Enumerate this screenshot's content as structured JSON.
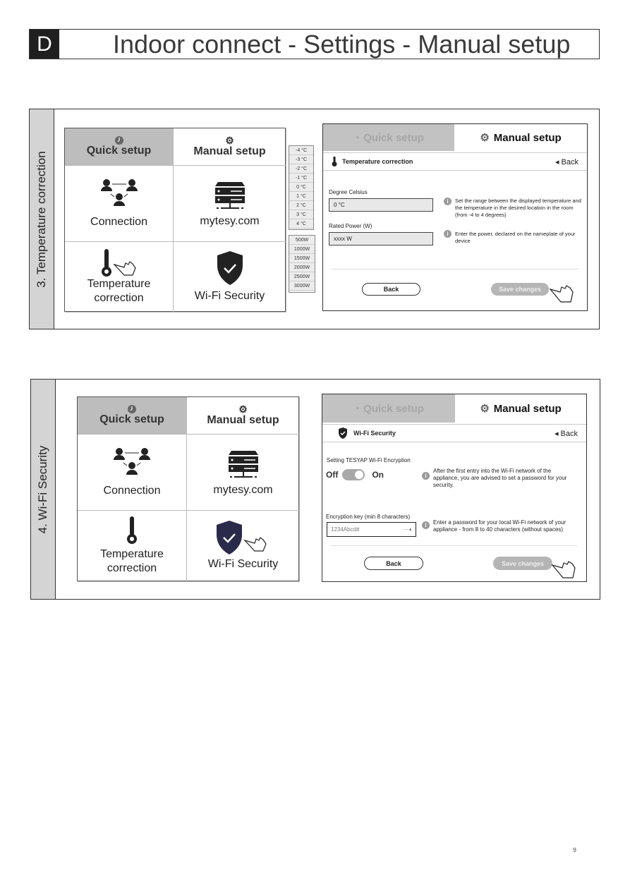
{
  "header": {
    "letter": "D",
    "title": "Indoor connect - Settings - Manual setup"
  },
  "sections": [
    {
      "sidebar_label": "3. Temperature correction",
      "menu": {
        "quick_setup": "Quick setup",
        "manual_setup": "Manual setup",
        "items": [
          "Connection",
          "mytesy.com",
          "Temperature\ncorrection",
          "Wi-Fi Security"
        ]
      },
      "temperature_options": [
        "-4 °C",
        "-3 °C",
        "-2 °C",
        "-1 °C",
        "0 °C",
        "1 °C",
        "2 °C",
        "3 °C",
        "4 °C"
      ],
      "power_options": [
        "500W",
        "1000W",
        "1500W",
        "2000W",
        "2500W",
        "3000W"
      ],
      "screen": {
        "tab_quick": "Quick setup",
        "tab_manual": "Manual setup",
        "subheader": "Temperature correction",
        "back_link": "Back",
        "degree_label": "Degree Celsius",
        "degree_value": "0 °C",
        "degree_info": "Set the range between the displayed temperature and the temperature in the desired location in the room (from -4 to 4 degrees)",
        "power_label": "Rated Power (W)",
        "power_value": "xxxx W",
        "power_info": "Enter the power, declared on the nameplate of your device",
        "back_button": "Back",
        "save_button": "Save changes"
      }
    },
    {
      "sidebar_label": "4. Wi-Fi Security",
      "menu": {
        "quick_setup": "Quick setup",
        "manual_setup": "Manual setup",
        "items": [
          "Connection",
          "mytesy.com",
          "Temperature\ncorrection",
          "Wi-Fi Security"
        ]
      },
      "screen": {
        "tab_quick": "Quick setup",
        "tab_manual": "Manual setup",
        "subheader": "Wi-Fi Security",
        "back_link": "Back",
        "encryption_label": "Setting TESYAP Wi-Fi Encryption",
        "toggle_off": "Off",
        "toggle_on": "On",
        "toggle_state": "on",
        "encryption_info": "After the first entry into the Wi-Fi network of the appliance, you are advised to set a password for your security.",
        "key_label": "Encryption key (min 8 characters)",
        "key_value": "1234Abcd#",
        "key_info": "Enter a password for your local Wi-Fi network of your appliance - from 8 to 40 characters (without spaces)",
        "back_button": "Back",
        "save_button": "Save changes"
      }
    }
  ],
  "page_number": "9"
}
